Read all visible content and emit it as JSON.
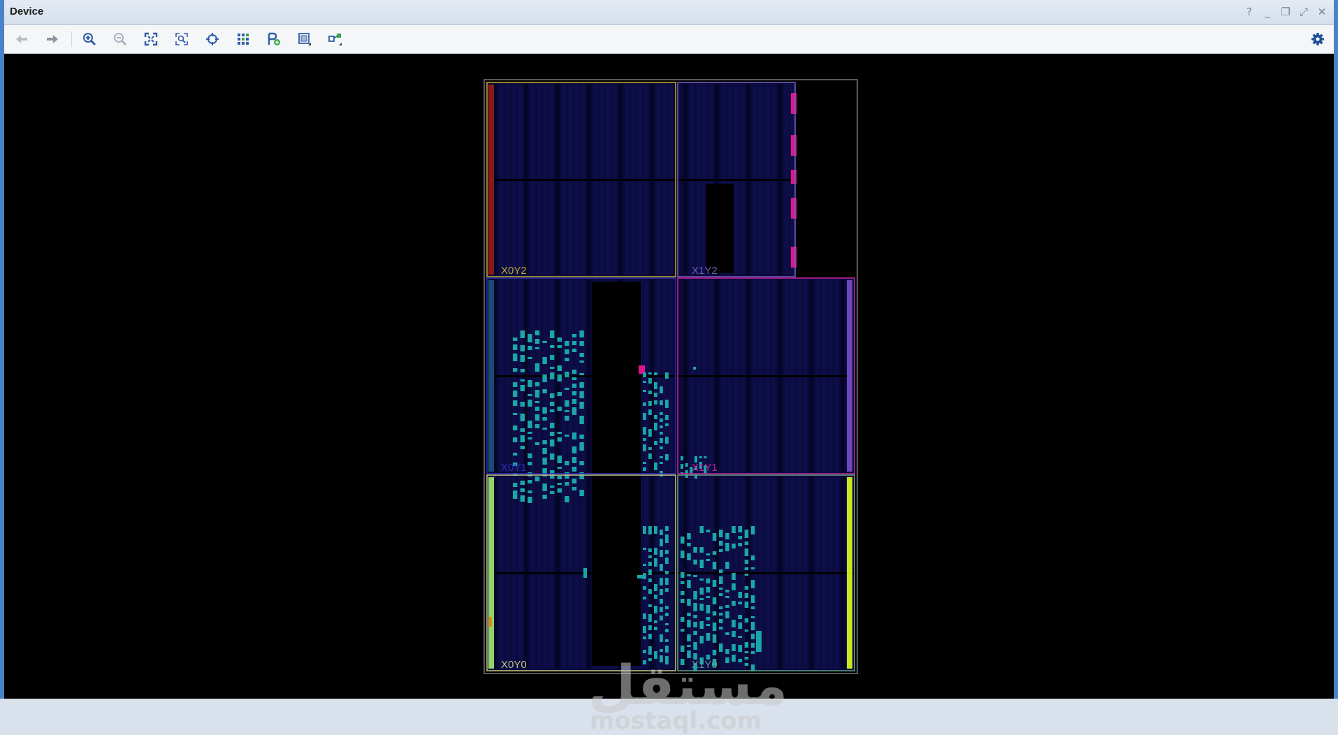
{
  "window": {
    "title": "Device",
    "controls": [
      "?",
      "_",
      "❐",
      "⤢",
      "✕"
    ]
  },
  "toolbar": {
    "buttons": [
      {
        "name": "back-button",
        "icon": "arrow-left-icon"
      },
      {
        "name": "forward-button",
        "icon": "arrow-right-icon"
      },
      {
        "name": "zoom-in-button",
        "icon": "zoom-in-icon"
      },
      {
        "name": "zoom-out-button",
        "icon": "zoom-out-icon"
      },
      {
        "name": "zoom-fit-button",
        "icon": "fit-icon"
      },
      {
        "name": "zoom-selection-button",
        "icon": "zoom-selection-icon"
      },
      {
        "name": "autofit-selection-button",
        "icon": "crosshair-icon"
      },
      {
        "name": "routing-resources-button",
        "icon": "routing-icon"
      },
      {
        "name": "add-pblock-button",
        "icon": "pblock-add-icon"
      },
      {
        "name": "draw-pblock-button",
        "icon": "draw-pblock-icon"
      },
      {
        "name": "show-connections-button",
        "icon": "connections-icon"
      }
    ],
    "settings_icon": "gear-icon"
  },
  "device": {
    "clock_regions": [
      {
        "label": "X0Y2",
        "color": "#b8a530"
      },
      {
        "label": "X1Y2",
        "color": "#6f5db8"
      },
      {
        "label": "X0Y1",
        "color": "#2a2ab8"
      },
      {
        "label": "X1Y1",
        "color": "#c020a0"
      },
      {
        "label": "X0Y0",
        "color": "#c0c080"
      },
      {
        "label": "X1Y0",
        "color": "#5a9a8a"
      }
    ],
    "colors": {
      "fabric": "#0a0a3a",
      "cell": "#1aa6a8",
      "io_pink": "#e0148c"
    }
  },
  "watermark": {
    "arabic": "مستقل",
    "latin": "mostaql.com"
  }
}
